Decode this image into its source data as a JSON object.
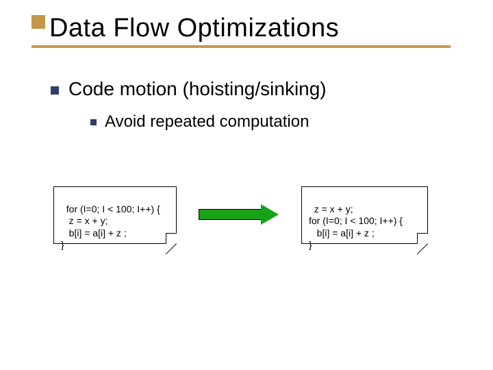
{
  "title": "Data Flow Optimizations",
  "bullet1": "Code motion (hoisting/sinking)",
  "bullet2": "Avoid repeated computation",
  "code_left": "for (I=0; I < 100; I++) {\n   z = x + y;\n   b[i] = a[i] + z ;\n}",
  "code_right": "z = x + y;\nfor (I=0; I < 100; I++) {\n   b[i] = a[i] + z ;\n}"
}
